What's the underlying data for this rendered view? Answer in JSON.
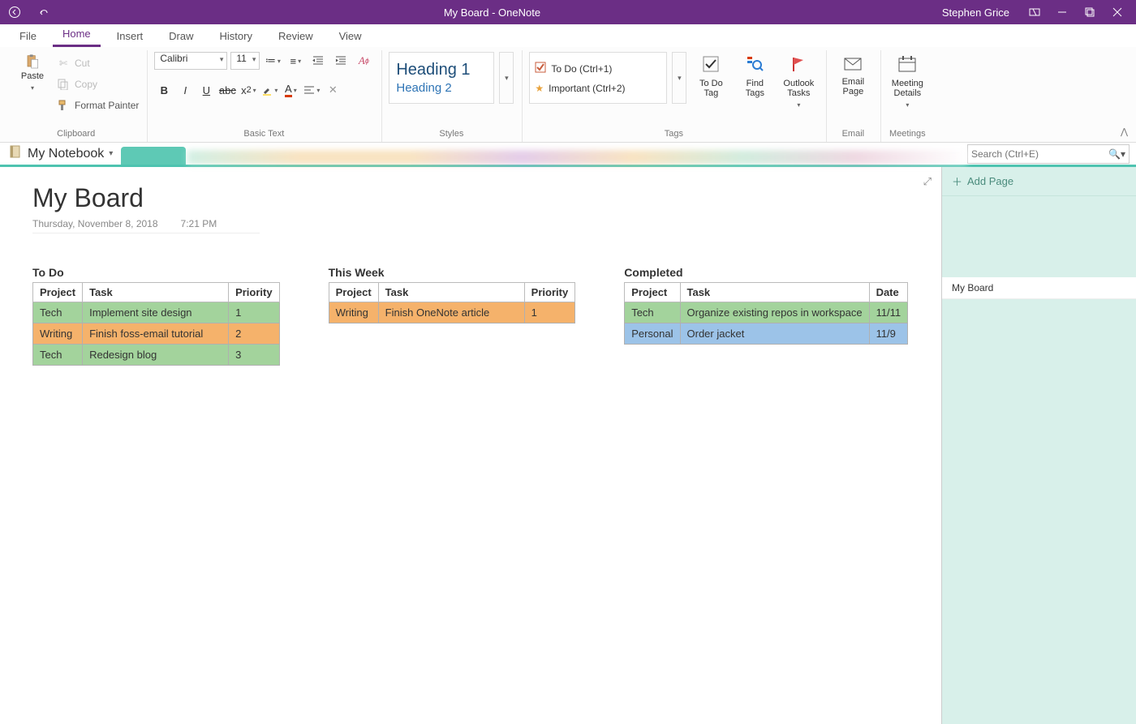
{
  "titlebar": {
    "title": "My Board  -  OneNote",
    "user": "Stephen Grice"
  },
  "menu": {
    "file": "File",
    "home": "Home",
    "insert": "Insert",
    "draw": "Draw",
    "history": "History",
    "review": "Review",
    "view": "View"
  },
  "ribbon": {
    "clipboard": {
      "label": "Clipboard",
      "paste": "Paste",
      "cut": "Cut",
      "copy": "Copy",
      "format_painter": "Format Painter"
    },
    "basic_text": {
      "label": "Basic Text",
      "font": "Calibri",
      "size": "11"
    },
    "styles": {
      "label": "Styles",
      "heading1": "Heading 1",
      "heading2": "Heading 2"
    },
    "tags": {
      "label": "Tags",
      "todo": "To Do (Ctrl+1)",
      "important": "Important (Ctrl+2)",
      "todo_btn": "To Do\nTag",
      "find_tags": "Find\nTags",
      "outlook_tasks": "Outlook\nTasks"
    },
    "email": {
      "label": "Email",
      "email_page": "Email\nPage"
    },
    "meetings": {
      "label": "Meetings",
      "meeting_details": "Meeting\nDetails"
    }
  },
  "notebook": {
    "name": "My Notebook"
  },
  "search": {
    "placeholder": "Search (Ctrl+E)"
  },
  "page": {
    "title": "My Board",
    "date": "Thursday, November 8, 2018",
    "time": "7:21 PM"
  },
  "boards": {
    "todo": {
      "title": "To Do",
      "headers": [
        "Project",
        "Task",
        "Priority"
      ],
      "rows": [
        {
          "color": "green",
          "cells": [
            "Tech",
            "Implement site design",
            "1"
          ]
        },
        {
          "color": "orange",
          "cells": [
            "Writing",
            "Finish foss-email tutorial",
            "2"
          ]
        },
        {
          "color": "green",
          "cells": [
            "Tech",
            "Redesign blog",
            "3"
          ]
        }
      ]
    },
    "thisweek": {
      "title": "This Week",
      "headers": [
        "Project",
        "Task",
        "Priority"
      ],
      "rows": [
        {
          "color": "orange",
          "cells": [
            "Writing",
            "Finish OneNote article",
            "1"
          ]
        }
      ]
    },
    "completed": {
      "title": "Completed",
      "headers": [
        "Project",
        "Task",
        "Date"
      ],
      "rows": [
        {
          "color": "green",
          "cells": [
            "Tech",
            "Organize existing repos in workspace",
            "11/11"
          ]
        },
        {
          "color": "blue",
          "cells": [
            "Personal",
            "Order jacket",
            "11/9"
          ]
        }
      ]
    }
  },
  "pagelist": {
    "add": "Add Page",
    "pages": [
      "My Board"
    ]
  },
  "colors": {
    "purple": "#6b2e85",
    "teal": "#4ec3b0"
  }
}
